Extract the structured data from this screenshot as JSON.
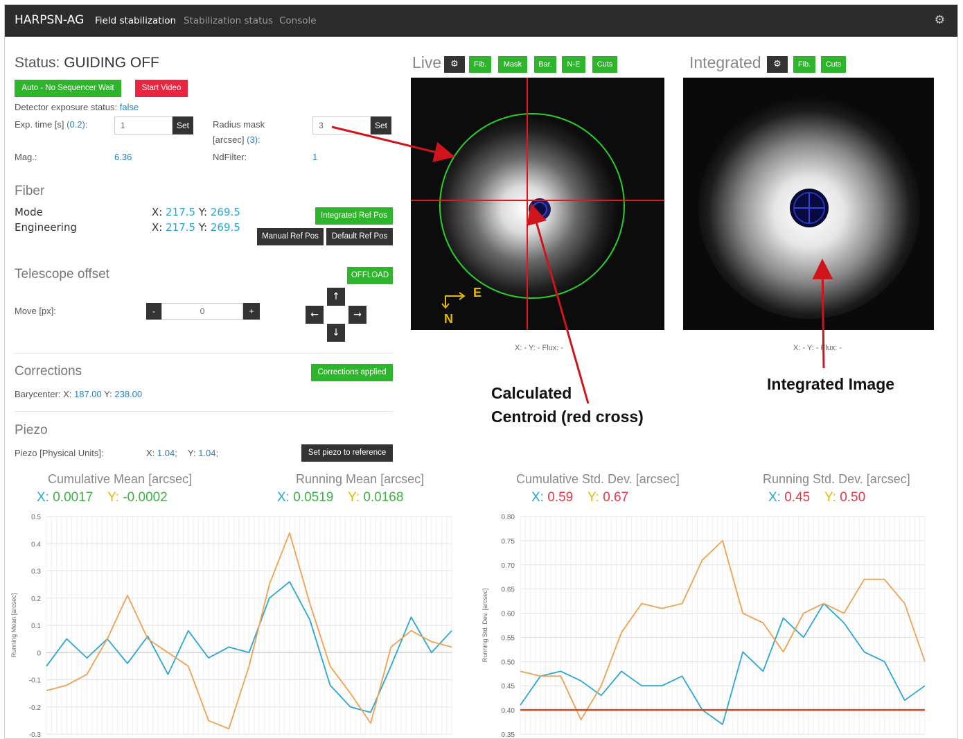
{
  "nav": {
    "brand": "HARPSN-AG",
    "items": [
      "Field stabilization",
      "Stabilization status",
      "Console"
    ]
  },
  "status": {
    "prefix": "Status:",
    "value": "GUIDING OFF",
    "auto_button": "Auto - No Sequencer Wait",
    "video_button": "Start Video",
    "detector_label": "Detector exposure status:",
    "detector_value": "false",
    "exp_label": "Exp. time [s]",
    "exp_hint": "(0.2):",
    "exp_value": "1",
    "set_label": "Set",
    "radius_label_1": "Radius mask",
    "radius_label_2": "[arcsec]",
    "radius_hint": "(3):",
    "radius_value": "3",
    "mag_label": "Mag.:",
    "mag_value": "6.36",
    "nd_label": "NdFilter:",
    "nd_value": "1"
  },
  "fiber": {
    "title": "Fiber",
    "mode_label": "Mode",
    "eng_label": "Engineering",
    "x_label": "X:",
    "y_label": "Y:",
    "mode_x": "217.5",
    "mode_y": "269.5",
    "eng_x": "217.5",
    "eng_y": "269.5",
    "integrated_button": "Integrated Ref Pos",
    "manual_button": "Manual Ref Pos",
    "default_button": "Default Ref Pos"
  },
  "offset": {
    "title": "Telescope offset",
    "offload_button": "OFFLOAD",
    "move_label": "Move [px]:",
    "move_value": "0",
    "minus": "-",
    "plus": "+"
  },
  "corrections": {
    "title": "Corrections",
    "applied_button": "Corrections applied",
    "barycenter_label": "Barycenter: X:",
    "bary_x": "187.00",
    "y_label": "Y:",
    "bary_y": "238.00"
  },
  "piezo": {
    "title": "Piezo",
    "label": "Piezo [Physical Units]:",
    "x_label": "X:",
    "x_value": "1.04;",
    "y_label": "Y:",
    "y_value": "1.04;",
    "button": "Set piezo to reference"
  },
  "live": {
    "title": "Live",
    "buttons": [
      "Fib.",
      "Mask",
      "Bar.",
      "N-E",
      "Cuts"
    ],
    "readout": "X: - Y: - Flux: -",
    "compass_e": "E",
    "compass_n": "N"
  },
  "integrated": {
    "title": "Integrated",
    "buttons": [
      "Fib.",
      "Cuts"
    ],
    "readout": "X: - Y: - Flux: -"
  },
  "annotations": {
    "centroid_1": "Calculated",
    "centroid_2": "Centroid (red cross)",
    "integrated": "Integrated Image"
  },
  "stats": {
    "cum_mean_title": "Cumulative Mean [arcsec]",
    "cum_mean_x": "0.0017",
    "cum_mean_y": "-0.0002",
    "run_mean_title": "Running Mean [arcsec]",
    "run_mean_x": "0.0519",
    "run_mean_y": "0.0168",
    "cum_std_title": "Cumulative Std. Dev. [arcsec]",
    "cum_std_x": "0.59",
    "cum_std_y": "0.67",
    "run_std_title": "Running Std. Dev. [arcsec]",
    "run_std_x": "0.45",
    "run_std_y": "0.50",
    "x_label": "X:",
    "y_label": "Y:"
  },
  "colors": {
    "green_button": "#2fb52c",
    "red_button": "#e8263f",
    "series_x": "#2aa6d5",
    "series_y": "#f0a050",
    "threshold": "#d9441c"
  },
  "chart_data": [
    {
      "type": "line",
      "ylabel": "Running Mean [arcsec]",
      "ylim": [
        -0.3,
        0.5
      ],
      "yticks": [
        "0.5",
        "0.4",
        "0.3",
        "0.2",
        "0.1",
        "0",
        "-0.1",
        "-0.2",
        "-0.3"
      ],
      "grid": true,
      "x": [
        0,
        5,
        10,
        15,
        20,
        25,
        30,
        35,
        40,
        45,
        50,
        55,
        60,
        65,
        70,
        75,
        80,
        85,
        90,
        95,
        100
      ],
      "series": [
        {
          "values": [
            -0.05,
            0.05,
            -0.02,
            0.05,
            -0.04,
            0.06,
            -0.08,
            0.08,
            -0.02,
            0.02,
            0.0,
            0.2,
            0.26,
            0.12,
            -0.12,
            -0.2,
            -0.22,
            -0.05,
            0.13,
            0.0,
            0.08
          ]
        },
        {
          "values": [
            -0.14,
            -0.12,
            -0.08,
            0.05,
            0.21,
            0.05,
            0.0,
            -0.05,
            -0.25,
            -0.28,
            -0.05,
            0.25,
            0.44,
            0.18,
            -0.05,
            -0.15,
            -0.26,
            0.02,
            0.08,
            0.04,
            0.02
          ]
        }
      ]
    },
    {
      "type": "line",
      "ylabel": "Running Std. Dev. [arcsec]",
      "ylim": [
        0.35,
        0.8
      ],
      "yticks": [
        "0.80",
        "0.75",
        "0.70",
        "0.65",
        "0.60",
        "0.55",
        "0.50",
        "0.45",
        "0.40",
        "0.35"
      ],
      "grid": true,
      "x": [
        0,
        5,
        10,
        15,
        20,
        25,
        30,
        35,
        40,
        45,
        50,
        55,
        60,
        65,
        70,
        75,
        80,
        85,
        90,
        95,
        100
      ],
      "series": [
        {
          "values": [
            0.41,
            0.47,
            0.48,
            0.46,
            0.43,
            0.48,
            0.45,
            0.45,
            0.47,
            0.4,
            0.37,
            0.52,
            0.48,
            0.59,
            0.55,
            0.62,
            0.58,
            0.52,
            0.5,
            0.42,
            0.45
          ]
        },
        {
          "values": [
            0.48,
            0.47,
            0.47,
            0.38,
            0.45,
            0.56,
            0.62,
            0.61,
            0.62,
            0.71,
            0.75,
            0.6,
            0.58,
            0.52,
            0.6,
            0.62,
            0.6,
            0.67,
            0.67,
            0.62,
            0.5
          ]
        },
        {
          "values": [
            0.4,
            0.4,
            0.4,
            0.4,
            0.4,
            0.4,
            0.4,
            0.4,
            0.4,
            0.4,
            0.4,
            0.4,
            0.4,
            0.4,
            0.4,
            0.4,
            0.4,
            0.4,
            0.4,
            0.4,
            0.4
          ]
        }
      ]
    }
  ]
}
